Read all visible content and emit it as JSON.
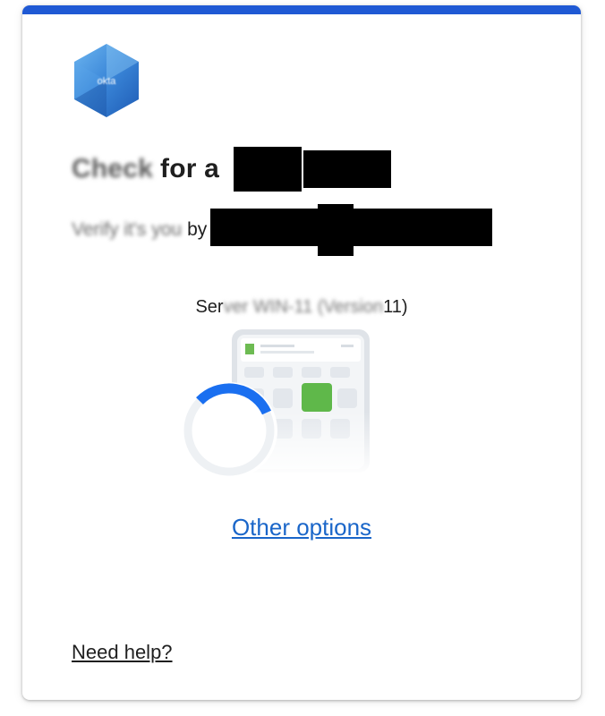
{
  "dialog": {
    "title_prefix_obscured": "Check",
    "title_visible": "for a",
    "subtitle_prefix_obscured": "Verify it's you",
    "subtitle_visible": "by",
    "server_prefix": "Ser",
    "server_obscured": "ver WIN-11 (Version",
    "server_suffix": "11)",
    "other_options_label": "Other options",
    "need_help_label": "Need help?"
  },
  "logo": {
    "label_obscured": "okta"
  },
  "colors": {
    "accent_bar": "#1f59d4",
    "link": "#1a66c9",
    "spinner": "#1a6ff0",
    "tile_highlight": "#5fb84a"
  },
  "icons": {
    "logo": "hexagon-logo-icon",
    "spinner": "loading-spinner-icon",
    "device": "tablet-device-icon"
  }
}
